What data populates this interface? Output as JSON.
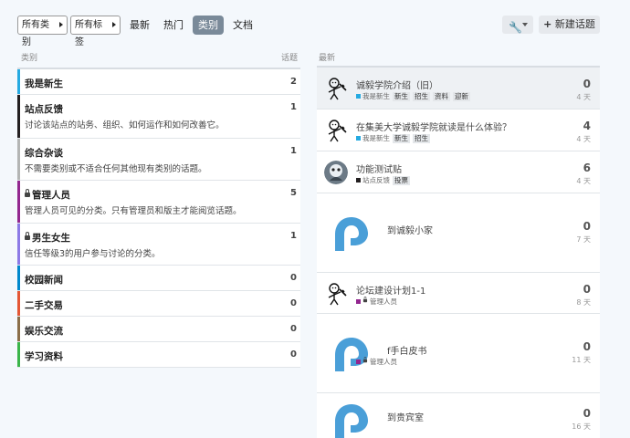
{
  "nav": {
    "filter_category": "所有类别",
    "filter_tag": "所有标签",
    "tabs": [
      "最新",
      "热门",
      "类别",
      "文档"
    ],
    "active_tab": "类别",
    "new_topic": "新建话题"
  },
  "categories_header": {
    "label": "类别",
    "count_label": "话题"
  },
  "latest_header": {
    "label": "最新"
  },
  "categories": [
    {
      "name": "我是新生",
      "desc": "",
      "count": "2",
      "color": "#25aae1",
      "locked": false
    },
    {
      "name": "站点反馈",
      "desc": "讨论该站点的站务、组织、如何运作和如何改善它。",
      "count": "1",
      "color": "#231f20",
      "locked": false
    },
    {
      "name": "综合杂谈",
      "desc": "不需要类别或不适合任何其他现有类别的话题。",
      "count": "1",
      "color": "#b3b5b4",
      "locked": false
    },
    {
      "name": "管理人员",
      "desc": "管理人员可见的分类。只有管理员和版主才能阅览话题。",
      "count": "5",
      "color": "#92278f",
      "locked": true
    },
    {
      "name": "男生女生",
      "desc": "信任等级3的用户参与讨论的分类。",
      "count": "1",
      "color": "#8c7ae6",
      "locked": true
    },
    {
      "name": "校园新闻",
      "desc": "",
      "count": "0",
      "color": "#0088cc",
      "locked": false
    },
    {
      "name": "二手交易",
      "desc": "",
      "count": "0",
      "color": "#e45735",
      "locked": false
    },
    {
      "name": "娱乐交流",
      "desc": "",
      "count": "0",
      "color": "#8a6e49",
      "locked": false
    },
    {
      "name": "学习资料",
      "desc": "",
      "count": "0",
      "color": "#3ab54a",
      "locked": false
    }
  ],
  "topics": [
    {
      "title": "诚毅学院介绍（旧）",
      "category": "我是新生",
      "cat_color": "#25aae1",
      "locked": false,
      "tags": [
        "新生",
        "招生",
        "资料",
        "迎新"
      ],
      "replies": "0",
      "age": "4 天",
      "avatar": "stick"
    },
    {
      "title": "在集美大学诚毅学院就读是什么体验？",
      "category": "我是新生",
      "cat_color": "#25aae1",
      "locked": false,
      "tags": [
        "新生",
        "招生"
      ],
      "replies": "4",
      "age": "4 天",
      "avatar": "stick"
    },
    {
      "title": "功能测试贴",
      "category": "站点反馈",
      "cat_color": "#231f20",
      "locked": false,
      "tags": [
        "投票"
      ],
      "replies": "6",
      "age": "4 天",
      "avatar": "photo"
    },
    {
      "title": "到诚毅小家",
      "category": "",
      "cat_color": "",
      "locked": false,
      "tags": [],
      "replies": "0",
      "age": "7 天",
      "avatar": "logo"
    },
    {
      "title": "论坛建设计划1-1",
      "category": "管理人员",
      "cat_color": "#92278f",
      "locked": true,
      "tags": [],
      "replies": "0",
      "age": "8 天",
      "avatar": "stick"
    },
    {
      "title": "f手白皮书",
      "category": "管理人员",
      "cat_color": "#92278f",
      "locked": true,
      "tags": [],
      "replies": "0",
      "age": "11 天",
      "avatar": "logo"
    },
    {
      "title": "到贵宾室",
      "category": "",
      "cat_color": "",
      "locked": false,
      "tags": [],
      "replies": "0",
      "age": "16 天",
      "avatar": "logo"
    }
  ]
}
